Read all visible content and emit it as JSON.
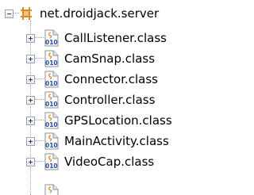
{
  "package": {
    "name": "net.droidjack.server",
    "expander_state": "expanded",
    "icon": "package-icon"
  },
  "classes": [
    {
      "name": "CallListener.class",
      "icon": "class-file-icon",
      "expander_state": "collapsed"
    },
    {
      "name": "CamSnap.class",
      "icon": "class-file-icon",
      "expander_state": "collapsed"
    },
    {
      "name": "Connector.class",
      "icon": "class-file-icon",
      "expander_state": "collapsed"
    },
    {
      "name": "Controller.class",
      "icon": "class-file-icon",
      "expander_state": "collapsed"
    },
    {
      "name": "GPSLocation.class",
      "icon": "class-file-icon",
      "expander_state": "collapsed"
    },
    {
      "name": "MainActivity.class",
      "icon": "class-file-icon",
      "expander_state": "collapsed"
    },
    {
      "name": "VideoCap.class",
      "icon": "class-file-icon",
      "expander_state": "collapsed"
    }
  ],
  "colors": {
    "package_icon": "#d98b2b",
    "class_file_label": "#2b4aa0"
  }
}
